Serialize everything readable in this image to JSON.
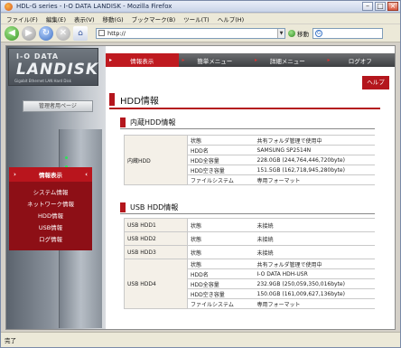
{
  "window": {
    "title": "HDL-G series - I-O DATA LANDISK - Mozilla Firefox"
  },
  "menubar": {
    "items": [
      "ファイル(F)",
      "編集(E)",
      "表示(V)",
      "移動(G)",
      "ブックマーク(B)",
      "ツール(T)",
      "ヘルプ(H)"
    ]
  },
  "navbar": {
    "url": "http://",
    "go_label": "移動",
    "search_value": "G"
  },
  "sidebar": {
    "logo_top": "I-O DATA",
    "logo_main": "LANDISK",
    "logo_sub": "Gigabit Ethernet LAN Hard Disk",
    "manager_button": "管理者用ページ",
    "menu_title": "情報表示",
    "menu_items": [
      "システム情報",
      "ネットワーク情報",
      "HDD情報",
      "USB情報",
      "ログ情報"
    ]
  },
  "topnav": {
    "tabs": [
      "情報表示",
      "簡単メニュー",
      "詳細メニュー",
      "ログオフ"
    ]
  },
  "help_label": "ヘルプ",
  "page_title": "HDD情報",
  "internal": {
    "heading": "内蔵HDD情報",
    "row_label": "内蔵HDD",
    "fields": [
      {
        "label": "状態",
        "value": "共有フォルダ管理で使用中"
      },
      {
        "label": "HDD名",
        "value": "SAMSUNG SP2514N"
      },
      {
        "label": "HDD全容量",
        "value": "228.0GB (244,764,446,720byte)"
      },
      {
        "label": "HDD空き容量",
        "value": "151.5GB (162,718,945,280byte)"
      },
      {
        "label": "ファイルシステム",
        "value": "専用フォーマット"
      }
    ]
  },
  "usb": {
    "heading": "USB HDD情報",
    "hdd1": {
      "label": "USB HDD1",
      "field": "状態",
      "value": "未接続"
    },
    "hdd2": {
      "label": "USB HDD2",
      "field": "状態",
      "value": "未接続"
    },
    "hdd3": {
      "label": "USB HDD3",
      "field": "状態",
      "value": "未接続"
    },
    "hdd4": {
      "label": "USB HDD4",
      "fields": [
        {
          "label": "状態",
          "value": "共有フォルダ管理で使用中"
        },
        {
          "label": "HDD名",
          "value": "I-O DATA HDH-USR"
        },
        {
          "label": "HDD全容量",
          "value": "232.9GB (250,059,350,016byte)"
        },
        {
          "label": "HDD空き容量",
          "value": "150.0GB (161,009,627,136byte)"
        },
        {
          "label": "ファイルシステム",
          "value": "専用フォーマット"
        }
      ]
    }
  },
  "status": {
    "text": "完了"
  },
  "colors": {
    "accent": "#b4161d",
    "nav_dark": "#3c3e41"
  }
}
